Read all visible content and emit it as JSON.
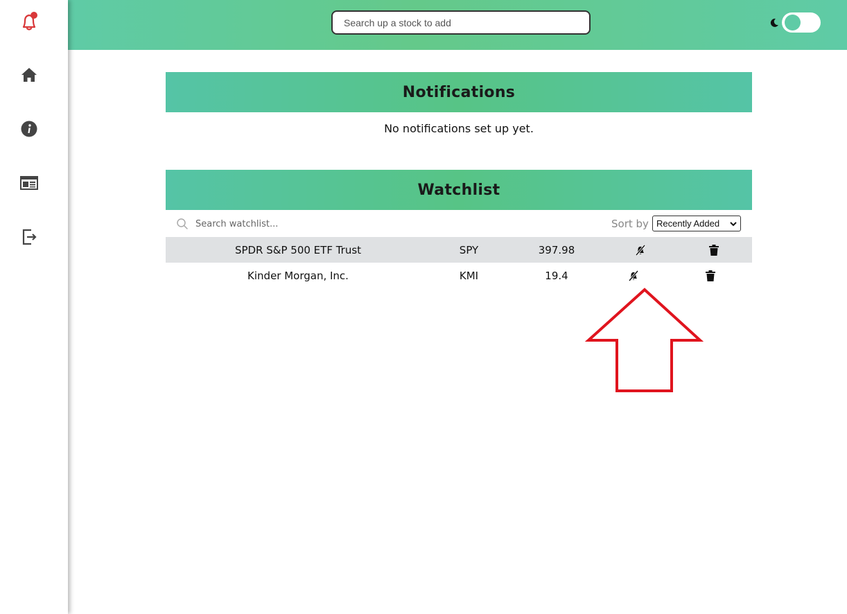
{
  "sidebar": {
    "items": [
      {
        "name": "notifications-bell-icon",
        "has_badge": true
      },
      {
        "name": "home-icon"
      },
      {
        "name": "info-icon"
      },
      {
        "name": "news-icon"
      },
      {
        "name": "logout-icon"
      }
    ]
  },
  "header": {
    "search_placeholder": "Search up a stock to add",
    "theme_toggle": {
      "mode": "dark-off"
    }
  },
  "notifications": {
    "title": "Notifications",
    "empty_message": "No notifications set up yet."
  },
  "watchlist": {
    "title": "Watchlist",
    "search_placeholder": "Search watchlist...",
    "sort_label": "Sort by",
    "sort_selected": "Recently Added",
    "rows": [
      {
        "name": "SPDR S&P 500 ETF Trust",
        "symbol": "SPY",
        "price": "397.98"
      },
      {
        "name": "Kinder Morgan, Inc.",
        "symbol": "KMI",
        "price": "19.4"
      }
    ]
  },
  "colors": {
    "accent": "#5fcba6",
    "alert_red": "#d9383a",
    "annotation_red": "#e0141e"
  }
}
